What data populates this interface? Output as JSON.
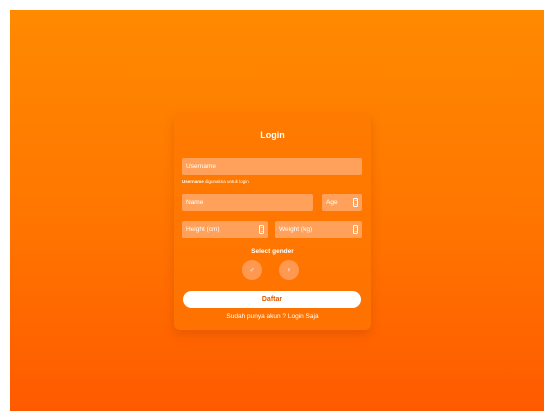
{
  "form": {
    "title": "Login",
    "username_placeholder": "Username",
    "hint_bold": "Username",
    "hint_text": " digunakna untuk login",
    "name_placeholder": "Name",
    "age_placeholder": "Age",
    "height_placeholder": "Height (cm)",
    "weight_placeholder": "Weight (kg)",
    "gender_label": "Select gender",
    "male_symbol": "♂",
    "female_symbol": "♀",
    "submit_label": "Daftar",
    "login_link": "Sudah punya akun ? Login Saja"
  },
  "icons": {
    "male": "male-icon",
    "female": "female-icon",
    "stepper": "stepper-icon"
  },
  "colors": {
    "background_top": "#ff8a00",
    "background_bottom": "#ff5a00",
    "field": "#ffa15a",
    "button_text": "#e05a00"
  }
}
